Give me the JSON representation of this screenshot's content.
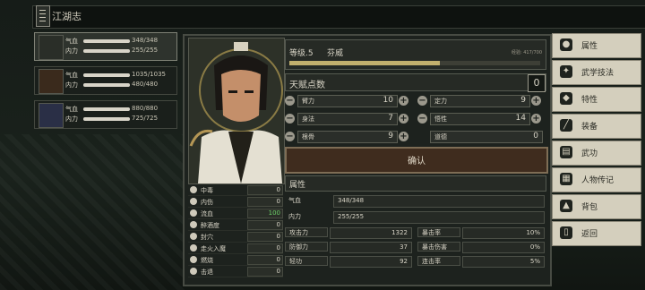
{
  "header": {
    "title": "江湖志"
  },
  "party": [
    {
      "hp_label": "气血",
      "hp": "348/348",
      "mp_label": "内力",
      "mp": "255/255",
      "hp_pct": 1.0,
      "mp_pct": 1.0,
      "avatar_icon": "hero-portrait-icon"
    },
    {
      "hp_label": "气血",
      "hp": "1035/1035",
      "mp_label": "内力",
      "mp": "480/480",
      "hp_pct": 1.0,
      "mp_pct": 1.0,
      "avatar_icon": "cat-companion-icon"
    },
    {
      "hp_label": "气血",
      "hp": "880/880",
      "mp_label": "内力",
      "mp": "725/725",
      "hp_pct": 1.0,
      "mp_pct": 1.0,
      "avatar_icon": "companion-portrait-icon"
    }
  ],
  "profile": {
    "level_label": "等级.5",
    "name": "芬威",
    "xp_text": "经验: 417/700",
    "xp_pct": 0.6
  },
  "talent": {
    "label": "天赋点数",
    "value": "0"
  },
  "attributes": [
    {
      "label": "臂力",
      "value": "10"
    },
    {
      "label": "定力",
      "value": "9"
    },
    {
      "label": "身法",
      "value": "7"
    },
    {
      "label": "悟性",
      "value": "14"
    },
    {
      "label": "根骨",
      "value": "9"
    },
    {
      "label": "道德",
      "value": "0"
    }
  ],
  "confirm_label": "确认",
  "section_label": "属性",
  "vitals": [
    {
      "label": "气血",
      "value": "348/348"
    },
    {
      "label": "内力",
      "value": "255/255"
    }
  ],
  "combat_stats": [
    {
      "label": "攻击力",
      "value": "1322"
    },
    {
      "label": "暴击率",
      "value": "10%"
    },
    {
      "label": "防御力",
      "value": "37"
    },
    {
      "label": "暴击伤害",
      "value": "0%"
    },
    {
      "label": "轻功",
      "value": "92"
    },
    {
      "label": "连击率",
      "value": "5%"
    }
  ],
  "status_effects": [
    {
      "label": "中毒",
      "value": "0"
    },
    {
      "label": "内伤",
      "value": "0"
    },
    {
      "label": "流血",
      "value": "100"
    },
    {
      "label": "醉酒度",
      "value": "0"
    },
    {
      "label": "封穴",
      "value": "0"
    },
    {
      "label": "走火入魔",
      "value": "0"
    },
    {
      "label": "燃烧",
      "value": "0"
    },
    {
      "label": "击退",
      "value": "0"
    }
  ],
  "menu": [
    {
      "label": "属性",
      "icon": "person-icon"
    },
    {
      "label": "武学技法",
      "icon": "martial-arts-icon"
    },
    {
      "label": "特性",
      "icon": "trait-icon"
    },
    {
      "label": "装备",
      "icon": "sword-icon"
    },
    {
      "label": "武功",
      "icon": "scroll-icon"
    },
    {
      "label": "人物传记",
      "icon": "biography-icon"
    },
    {
      "label": "背包",
      "icon": "bag-icon"
    },
    {
      "label": "返回",
      "icon": "door-icon"
    }
  ],
  "colors": {
    "accent_gold": "#c2b06d",
    "panel_bg": "#1d221e",
    "menu_bg": "#d4cfbd",
    "green_value": "#6ed36a"
  }
}
